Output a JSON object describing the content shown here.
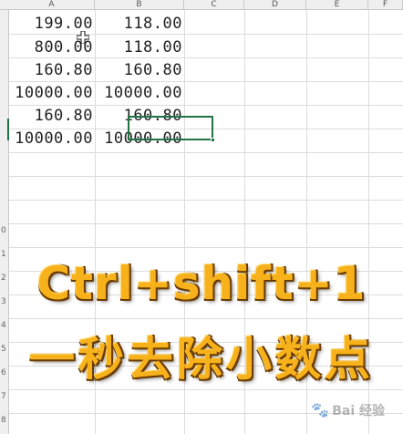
{
  "columns": [
    "A",
    "B",
    "C",
    "D",
    "E",
    "F"
  ],
  "rows": [
    "",
    "",
    "",
    "",
    "",
    "",
    "",
    "",
    "",
    "0",
    "1",
    "2",
    "3",
    "4",
    "5",
    "6",
    "7",
    "8"
  ],
  "cells": [
    {
      "a": "199.00",
      "b": "118.00"
    },
    {
      "a": "800.00",
      "b": "118.00"
    },
    {
      "a": "160.80",
      "b": "160.80"
    },
    {
      "a": "10000.00",
      "b": "10000.00"
    },
    {
      "a": "160.80",
      "b": "160.80"
    },
    {
      "a": "10000.00",
      "b": "10000.00"
    }
  ],
  "overlay": {
    "line1": "Ctrl+shift+1",
    "line2": "一秒去除小数点"
  },
  "watermark": "Bai 经验",
  "colors": {
    "overlay_text": "#f7b21b",
    "selection_border": "#217346"
  }
}
